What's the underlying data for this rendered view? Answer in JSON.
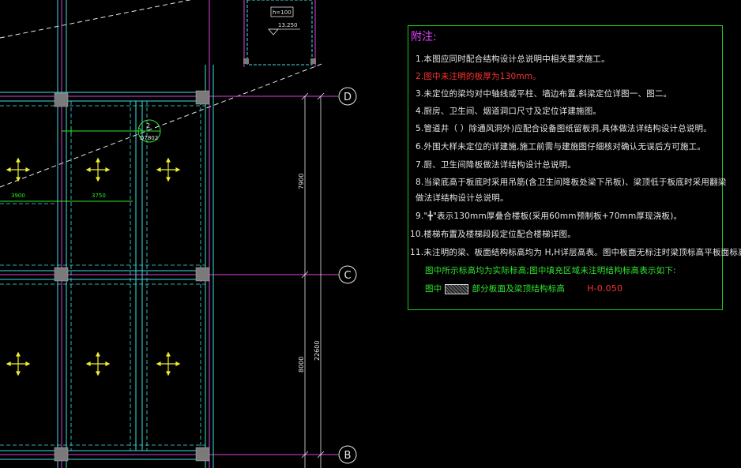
{
  "drawing": {
    "grid_labels": [
      "D",
      "C",
      "B"
    ],
    "dims": {
      "span_left": "3900",
      "span_right": "3750",
      "vertical_upper": "7900",
      "vertical_lower": "8000",
      "total": "22600"
    },
    "tag": {
      "number": "2",
      "code": "D7802"
    },
    "section_marks": {
      "h_value": "h=100",
      "elevation": "13.250"
    },
    "colors": {
      "background": "#000000",
      "axis_line": "#e040e0",
      "beam_line": "#40e0e0",
      "dim_line": "#30e830",
      "column_fill": "#7a7a7a",
      "symbol": "#f0f030"
    }
  },
  "notes": {
    "title": "附注:",
    "items": [
      "1.本图应同时配合结构设计总说明中相关要求施工。",
      "2.图中未注明的板厚为130mm。",
      "3.未定位的梁均对中轴线或平柱、墙边布置,斜梁定位详图一、图二。",
      "4.厨房、卫生间、烟道洞口尺寸及定位详建施图。",
      "5.管道井（  ）除通风洞外)应配合设备图纸留板洞,具体做法详结构设计总说明。",
      "6.外围大样未定位的详建施,施工前需与建施图仔细核对确认无误后方可施工。",
      "7.厨、卫生间降板做法详结构设计总说明。",
      "8.当梁底高于板底时采用吊筋(含卫生间降板处梁下吊板)、梁顶低于板底时采用翻梁",
      "   做法详结构设计总说明。",
      "9.\"╋\"表示130mm厚叠合楼板(采用60mm预制板+70mm厚现浇板)。",
      "10.楼梯布置及楼梯段段定位配合楼梯详图。",
      "11.未注明的梁、板面结构标高均为 H,H详层高表。图中板面无标注时梁顶标高平板面标高。"
    ],
    "green_1": "图中所示标高均为实际标高;图中填充区域未注明结构标高表示如下:",
    "green_2_prefix": "图中",
    "green_2_suffix": "部分板面及梁顶结构标高",
    "elev_value": "H-0.050"
  }
}
